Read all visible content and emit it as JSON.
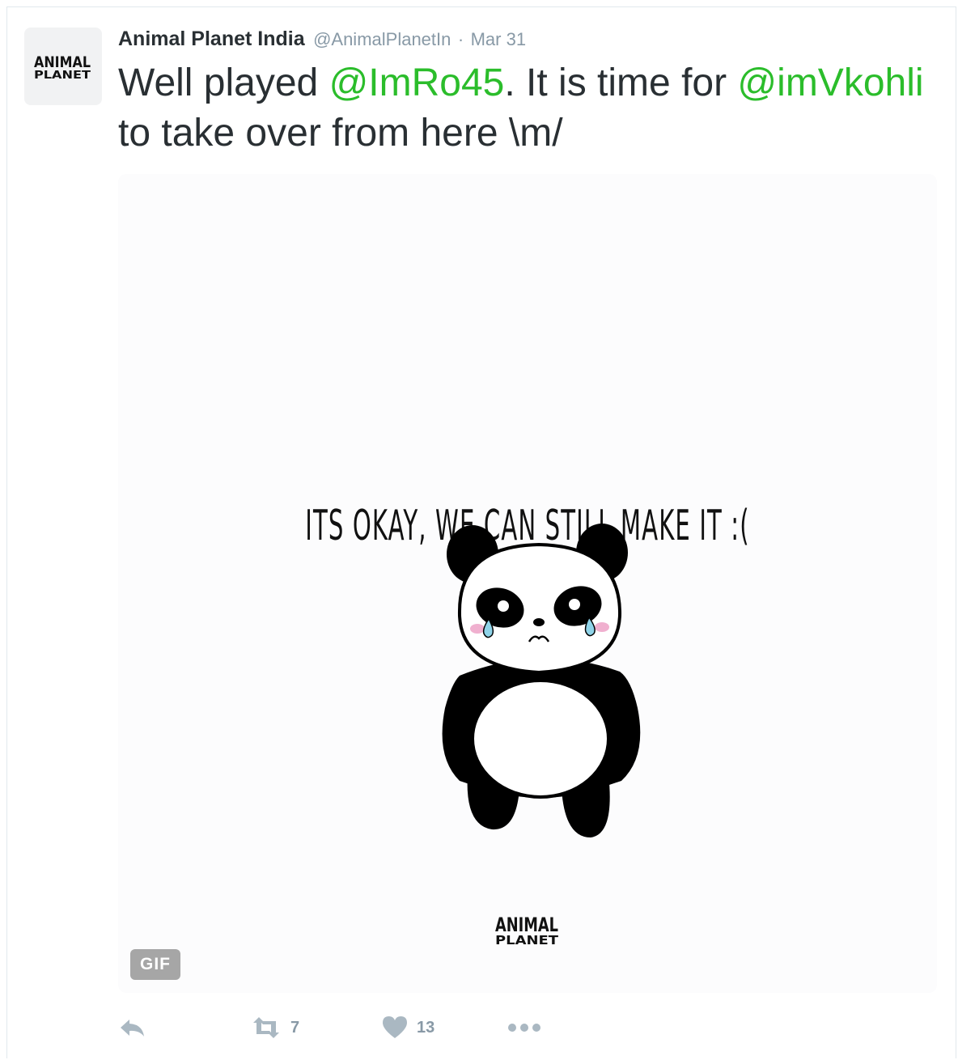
{
  "tweet": {
    "author_name": "Animal Planet India",
    "author_handle": "@AnimalPlanetIn",
    "separator": "·",
    "date": "Mar 31",
    "text_part1": "Well played ",
    "mention1": "@ImRo45",
    "text_part2": ". It is time for ",
    "mention2": "@imVkohli",
    "text_part3": " to take over from here \\m/",
    "avatar_logo_top": "ANIMAL",
    "avatar_logo_bottom": "PLANET"
  },
  "media": {
    "caption": "ITS OKAY, WE CAN STILL MAKE IT :(",
    "badge": "GIF",
    "logo_top": "ANIMAL",
    "logo_bottom": "PLANET"
  },
  "actions": {
    "retweet_count": "7",
    "like_count": "13"
  },
  "icons": [
    "reply-icon",
    "retweet-icon",
    "heart-icon",
    "more-icon"
  ],
  "colors": {
    "mention": "#2bbd2b",
    "meta": "#8899a6",
    "text": "#292f33"
  }
}
